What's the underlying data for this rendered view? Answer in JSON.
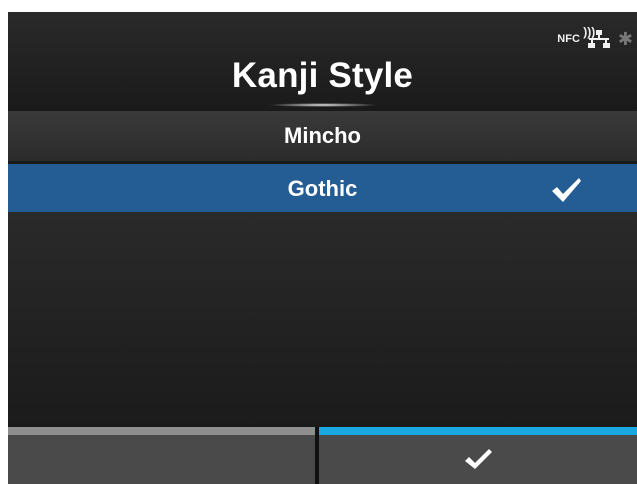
{
  "header": {
    "title": "Kanji Style",
    "status": {
      "nfc_label": "NFC"
    }
  },
  "options": {
    "items": [
      {
        "label": "Mincho",
        "selected": false
      },
      {
        "label": "Gothic",
        "selected": true
      }
    ]
  },
  "footer": {
    "left_button": "",
    "right_button_icon": "check-icon"
  },
  "colors": {
    "selected": "#235d93",
    "accent": "#1aa8e0",
    "background": "#111111"
  }
}
